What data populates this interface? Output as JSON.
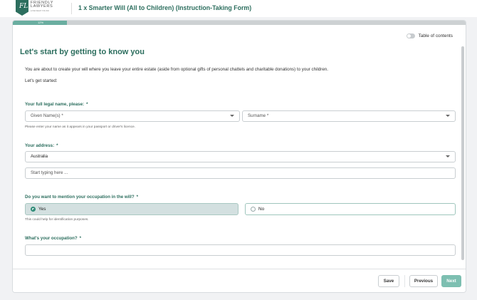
{
  "header": {
    "logo_initials": "FL",
    "brand_line1": "FRIENDLY",
    "brand_line2": "LAWYERS",
    "brand_tagline": "LOVE WHAT YOU DO",
    "title": "1 x Smarter Will (All to Children) (Instruction-Taking Form)"
  },
  "progress": {
    "label": "12%",
    "value": 0.12
  },
  "toc": {
    "label": "Table of contents"
  },
  "intro": {
    "heading": "Let's start by getting to know you",
    "paragraph": "You are about to create your will where you leave your entire estate (aside from optional gifts of personal chattels and charitable donations) to your children.",
    "started": "Let's get started:"
  },
  "name_section": {
    "question": "Your full legal name, please:",
    "required": "*",
    "given_placeholder": "Given Name(s) *",
    "surname_placeholder": "Surname *",
    "help": "Please enter your name as it appears in your passport or driver's licence."
  },
  "address_section": {
    "question": "Your address:",
    "required": "*",
    "country_value": "Australia",
    "address_placeholder": "Start typing here ..."
  },
  "occupation_mention": {
    "question": "Do you want to mention your occupation in the will?",
    "required": "*",
    "options": [
      {
        "label": "Yes",
        "selected": true
      },
      {
        "label": "No",
        "selected": false
      }
    ],
    "help": "This could help for identification purposes."
  },
  "occupation": {
    "question": "What's your occupation?",
    "required": "*",
    "value": ""
  },
  "footer": {
    "save_label": "Save",
    "previous_label": "Previous",
    "next_label": "Next"
  },
  "colors": {
    "accent": "#2c6e5e",
    "next_button": "#7dbfb1",
    "selected_option_bg": "#d3e0e0"
  }
}
